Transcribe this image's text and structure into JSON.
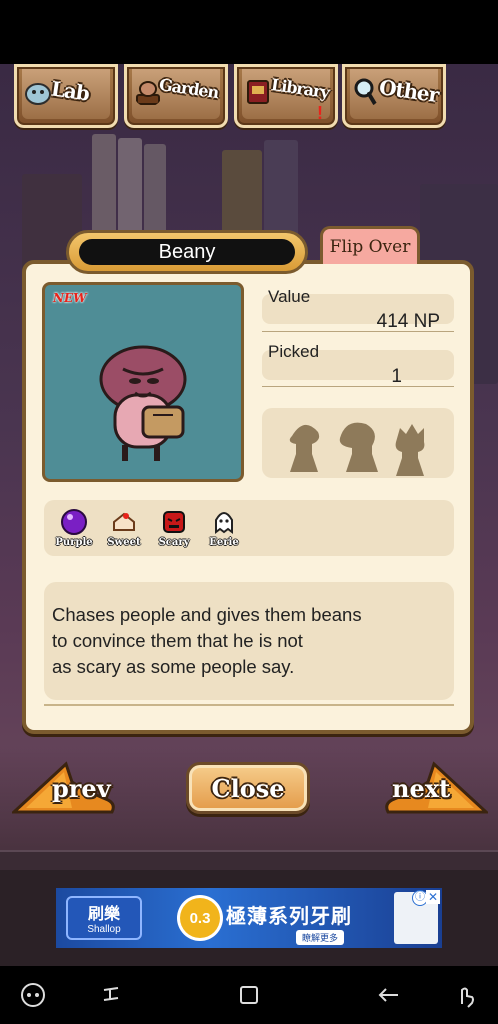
{
  "tabs": [
    {
      "label": "Lab",
      "icon": "flask-creature-icon"
    },
    {
      "label": "Garden",
      "icon": "mushroom-pot-icon"
    },
    {
      "label": "Library",
      "icon": "book-icon",
      "alert": "!"
    },
    {
      "label": "Other",
      "icon": "magnifier-icon"
    }
  ],
  "card": {
    "name": "Beany",
    "flip_label": "Flip Over",
    "new_badge": "NEW",
    "value_label": "Value",
    "value": "414 NP",
    "picked_label": "Picked",
    "picked": "1",
    "traits": [
      {
        "label": "Purple",
        "icon": "purple-orb-icon"
      },
      {
        "label": "Sweet",
        "icon": "cake-icon"
      },
      {
        "label": "Scary",
        "icon": "scary-mask-icon"
      },
      {
        "label": "Eerie",
        "icon": "ghost-icon"
      }
    ],
    "description_lines": [
      "Chases people and gives them beans",
      "to convince them that he is not",
      "as scary as some people say."
    ]
  },
  "nav": {
    "prev_label": "prev",
    "close_label": "Close",
    "next_label": "next"
  },
  "ad": {
    "brand_cn": "刷樂",
    "brand_en": "Shallop",
    "badge": "0.3",
    "title": "極薄系列牙刷",
    "cta": "瞭解更多",
    "info_icon": "ⓘ",
    "close_icon": "✕"
  },
  "colors": {
    "panel": "#fbf2dc",
    "panel_border": "#7b5b2e",
    "portrait_bg": "#4f8d96",
    "flip_tab": "#f6a9a0",
    "button_orange": "#e39a48"
  }
}
